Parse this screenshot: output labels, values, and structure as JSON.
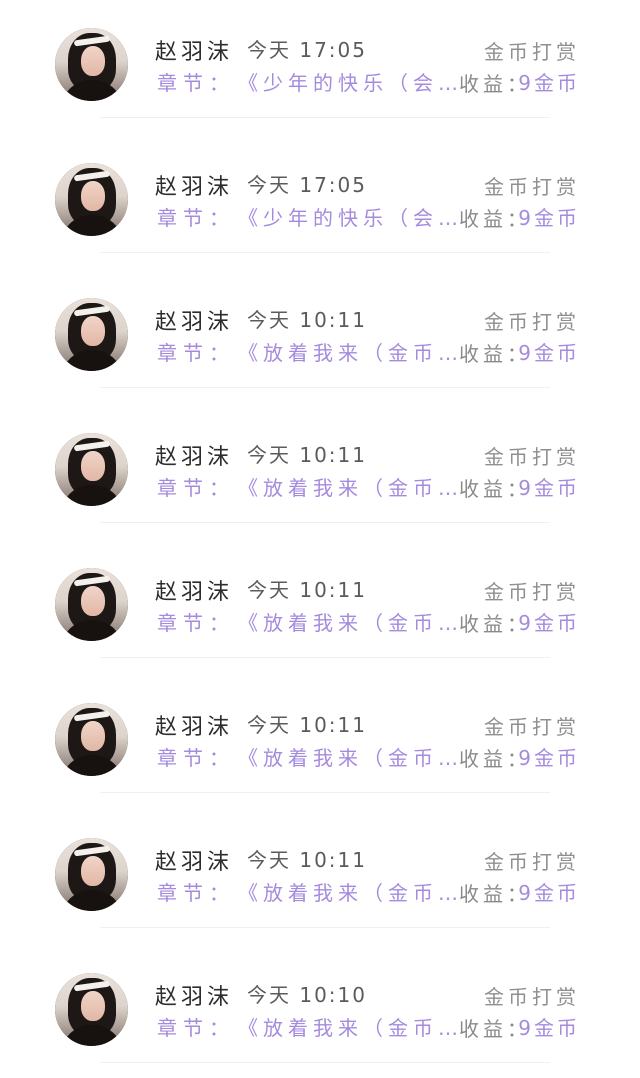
{
  "records": [
    {
      "name": "赵羽沫",
      "time": "今天 17:05",
      "type": "金币打赏",
      "chapter_label": "章节：",
      "chapter_title": "《少年的快乐（会…",
      "income_label": "收益：",
      "income_value": "9金币"
    },
    {
      "name": "赵羽沫",
      "time": "今天 17:05",
      "type": "金币打赏",
      "chapter_label": "章节：",
      "chapter_title": "《少年的快乐（会…",
      "income_label": "收益：",
      "income_value": "9金币"
    },
    {
      "name": "赵羽沫",
      "time": "今天 10:11",
      "type": "金币打赏",
      "chapter_label": "章节：",
      "chapter_title": "《放着我来（金币…",
      "income_label": "收益：",
      "income_value": "9金币"
    },
    {
      "name": "赵羽沫",
      "time": "今天 10:11",
      "type": "金币打赏",
      "chapter_label": "章节：",
      "chapter_title": "《放着我来（金币…",
      "income_label": "收益：",
      "income_value": "9金币"
    },
    {
      "name": "赵羽沫",
      "time": "今天 10:11",
      "type": "金币打赏",
      "chapter_label": "章节：",
      "chapter_title": "《放着我来（金币…",
      "income_label": "收益：",
      "income_value": "9金币"
    },
    {
      "name": "赵羽沫",
      "time": "今天 10:11",
      "type": "金币打赏",
      "chapter_label": "章节：",
      "chapter_title": "《放着我来（金币…",
      "income_label": "收益：",
      "income_value": "9金币"
    },
    {
      "name": "赵羽沫",
      "time": "今天 10:11",
      "type": "金币打赏",
      "chapter_label": "章节：",
      "chapter_title": "《放着我来（金币…",
      "income_label": "收益：",
      "income_value": "9金币"
    },
    {
      "name": "赵羽沫",
      "time": "今天 10:10",
      "type": "金币打赏",
      "chapter_label": "章节：",
      "chapter_title": "《放着我来（金币…",
      "income_label": "收益：",
      "income_value": "9金币"
    }
  ],
  "colors": {
    "accent": "#a58bdf",
    "name_text": "#2d2d2d",
    "secondary_text": "#8f8f8f",
    "divider": "#f0f0f0"
  }
}
